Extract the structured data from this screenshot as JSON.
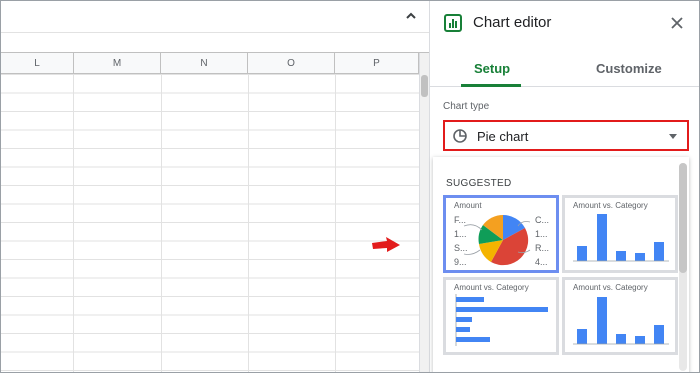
{
  "spreadsheet": {
    "columns": [
      "L",
      "M",
      "N",
      "O",
      "P"
    ]
  },
  "editor": {
    "title": "Chart editor",
    "tabs": [
      {
        "label": "Setup",
        "active": true
      },
      {
        "label": "Customize",
        "active": false
      }
    ],
    "chart_type_label": "Chart type",
    "chart_type_value": "Pie chart",
    "suggested_label": "SUGGESTED",
    "thumbnails": [
      {
        "title": "Amount",
        "type": "pie",
        "selected": true,
        "left_labels": [
          "F...",
          "1...",
          "S...",
          "9..."
        ],
        "right_labels": [
          "C...",
          "1...",
          "R...",
          "4..."
        ]
      },
      {
        "title": "Amount vs. Category",
        "type": "column",
        "selected": false
      },
      {
        "title": "Amount vs. Category",
        "type": "bar",
        "selected": false
      },
      {
        "title": "Amount vs. Category",
        "type": "column",
        "selected": false
      }
    ]
  },
  "colors": {
    "accent_green": "#188038",
    "highlight_red": "#e21b1b",
    "selection_blue": "#6d8ef0",
    "series_blue": "#4285f4",
    "pie_red": "#db4437",
    "pie_orange": "#f4a020",
    "pie_green": "#0f9d58",
    "pie_yellow": "#f4b400"
  },
  "icons": [
    "collapse-chevron-icon",
    "chart-icon",
    "close-icon",
    "pie-chart-icon",
    "dropdown-arrow-icon",
    "red-pointer-arrow"
  ]
}
